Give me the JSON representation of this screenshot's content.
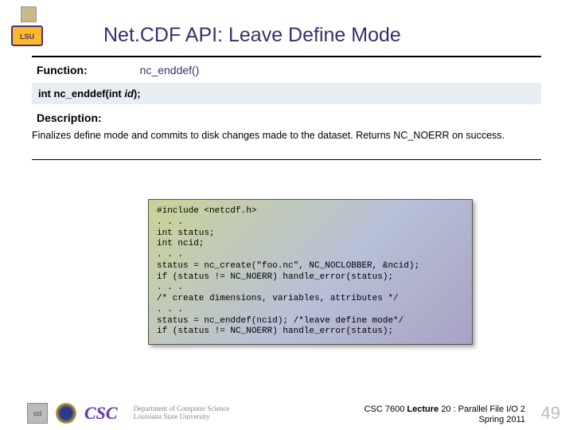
{
  "logo_text": "LSU",
  "title": "Net.CDF API: Leave Define Mode",
  "function_label": "Function:",
  "function_name": "nc_enddef()",
  "signature_prefix": "int nc_enddef(int ",
  "signature_param": "id",
  "signature_suffix": ");",
  "description_label": "Description:",
  "description_text": "Finalizes define mode and commits to disk changes made to the dataset. Returns NC_NOERR on success.",
  "code": "#include <netcdf.h>\n. . .\nint status;\nint ncid;\n. . .\nstatus = nc_create(\"foo.nc\", NC_NOCLOBBER, &ncid);\nif (status != NC_NOERR) handle_error(status);\n. . .\n/* create dimensions, variables, attributes */\n. . .\nstatus = nc_enddef(ncid); /*leave define mode*/\nif (status != NC_NOERR) handle_error(status);",
  "footer": {
    "csc": "CSC",
    "dept_line1": "Department of Computer Science",
    "dept_line2": "Louisiana State University",
    "course_prefix": "CSC 7600 ",
    "course_bold": "Lecture",
    "course_rest": " 20 : Parallel File I/O 2",
    "term": "Spring 2011",
    "page": "49"
  }
}
